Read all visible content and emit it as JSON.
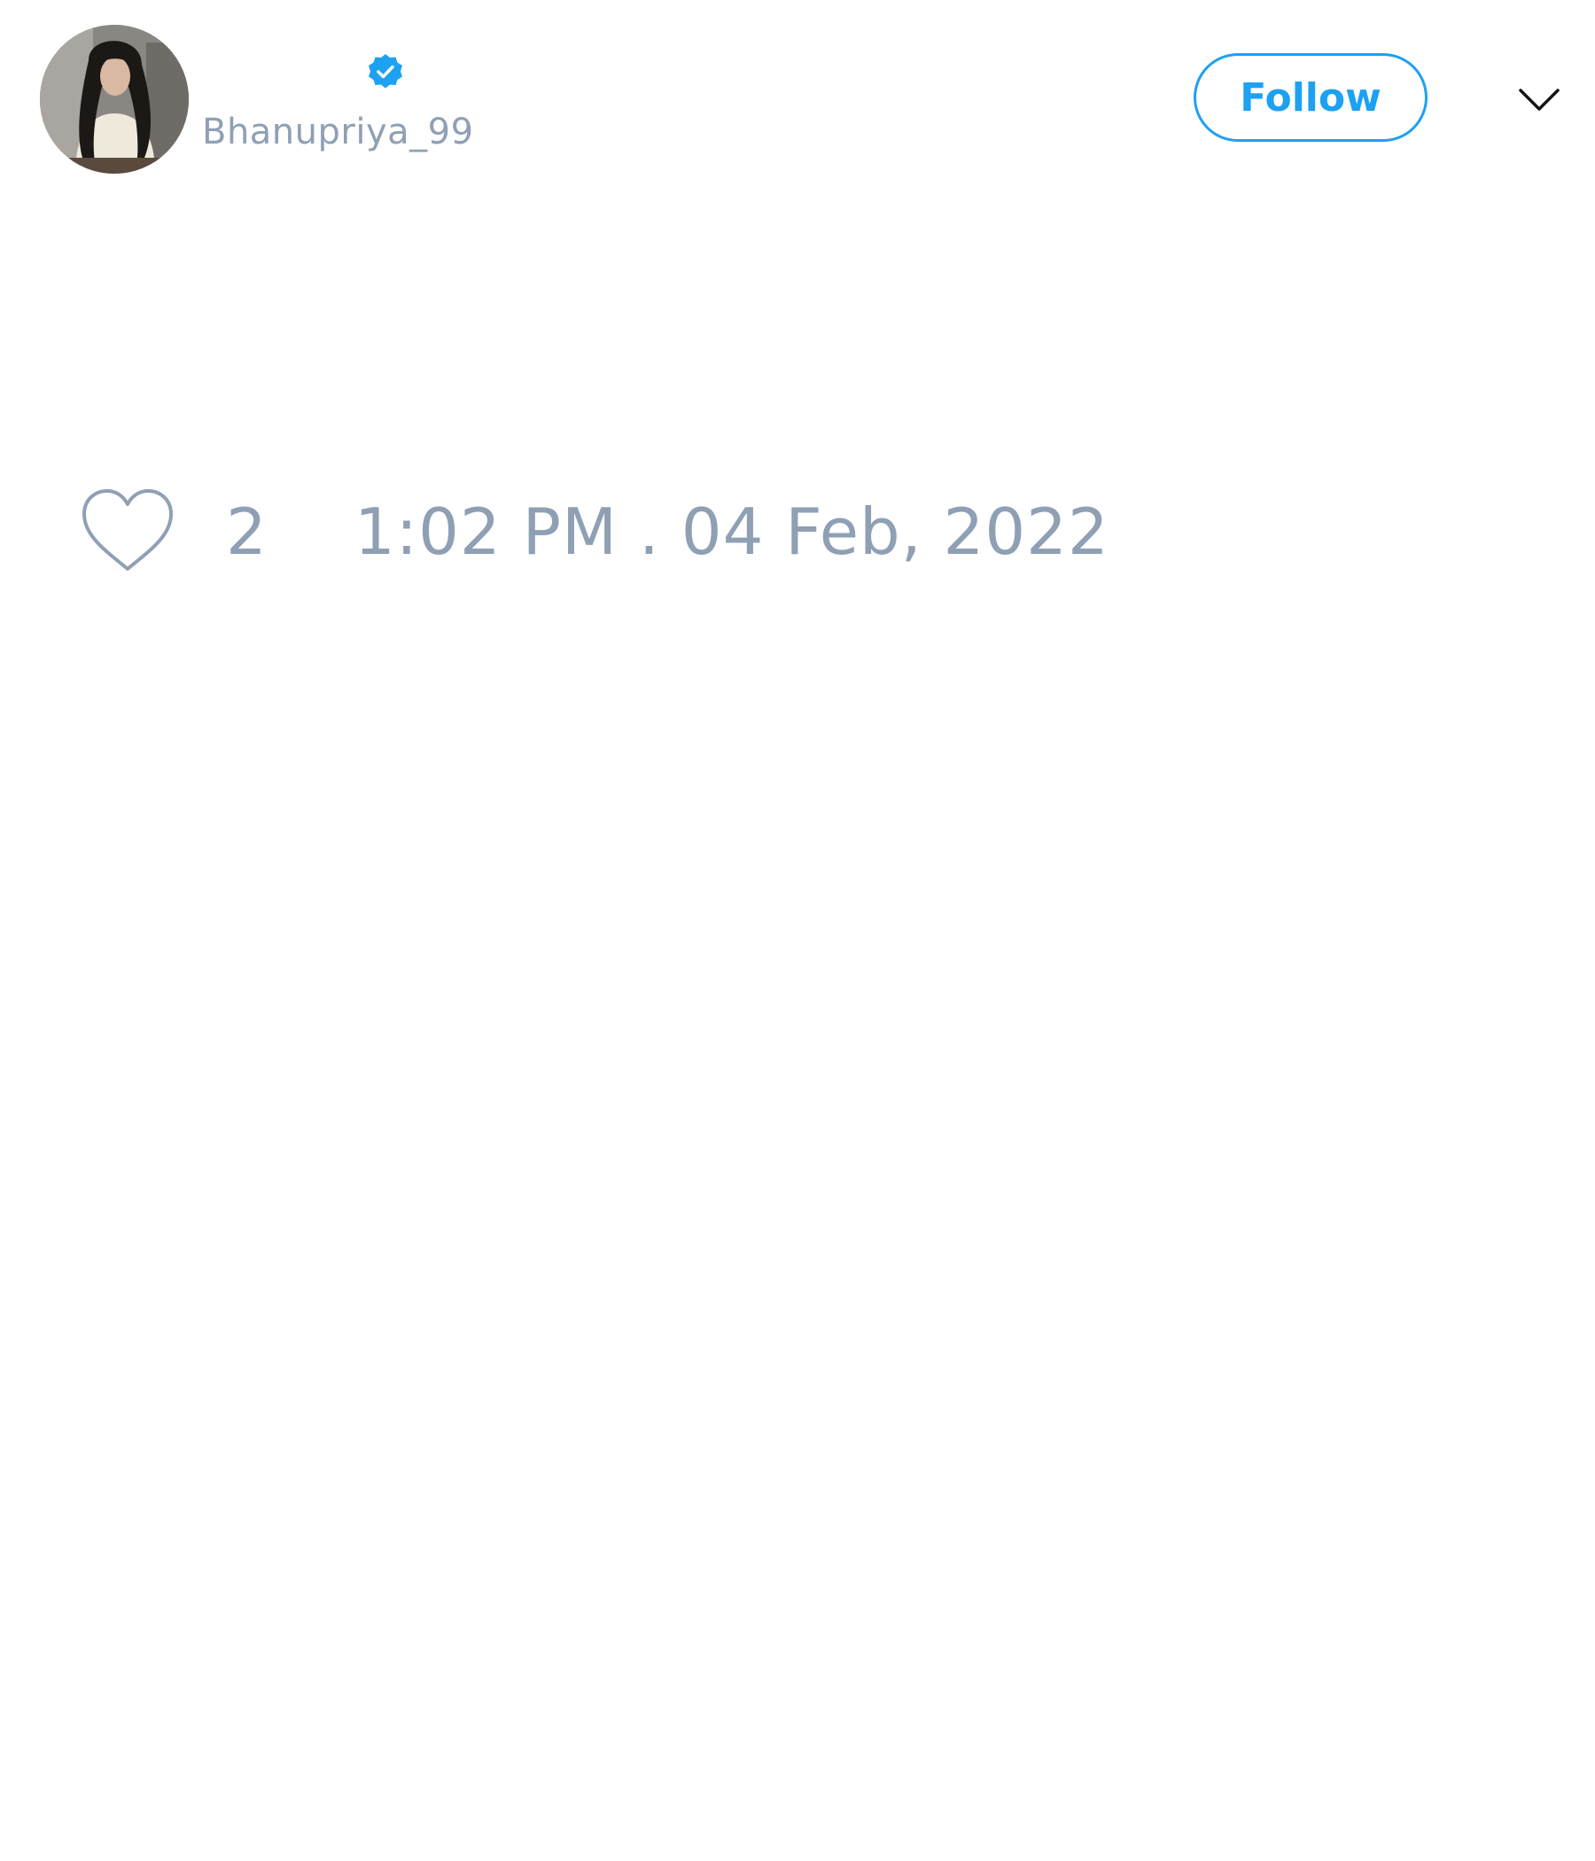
{
  "tweet": {
    "author": {
      "display_name": "",
      "handle": "Bhanupriya_99",
      "verified": true,
      "avatar": "profile-photo"
    },
    "follow_label": "Follow",
    "more_icon": "chevron-down-icon",
    "like_icon": "heart-outline-icon",
    "like_count": "2",
    "timestamp": "1:02 PM . 04 Feb, 2022"
  },
  "colors": {
    "accent": "#1da1f2",
    "muted_text": "#8fa0b5",
    "background": "#ffffff"
  }
}
